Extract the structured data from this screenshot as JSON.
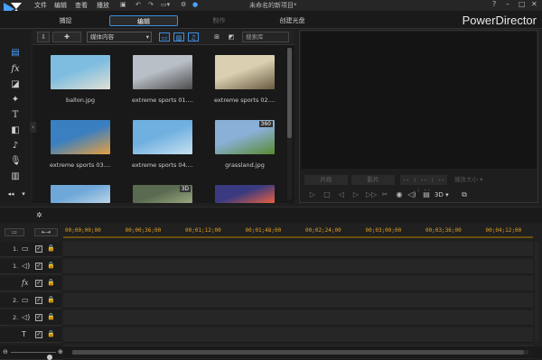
{
  "menu": {
    "file": "文件",
    "edit": "编辑",
    "view": "查看",
    "play": "播放"
  },
  "window_title": "未命名的新项目*",
  "brand": "PowerDirector",
  "modes": {
    "capture": "捕捉",
    "edit": "编辑",
    "produce": "制作",
    "create_disc": "创建光盘"
  },
  "library": {
    "media_filter": "媒体内容",
    "search_placeholder": "搜索库",
    "items": [
      {
        "name": "ballon.jpg",
        "colors": [
          "#7fbde0",
          "#e2e0d5"
        ]
      },
      {
        "name": "extreme sports 01....",
        "colors": [
          "#b9bfc6",
          "#4c4c4c"
        ]
      },
      {
        "name": "extreme sports 02....",
        "colors": [
          "#d8d0b0",
          "#6a5a40"
        ]
      },
      {
        "name": "extreme sports 03....",
        "colors": [
          "#3a7fc0",
          "#e8a040"
        ]
      },
      {
        "name": "extreme sports 04....",
        "colors": [
          "#6fb0e0",
          "#c8e0f0"
        ]
      },
      {
        "name": "grassland.jpg",
        "colors": [
          "#8ab0d8",
          "#5a8a30"
        ],
        "badge": "360"
      },
      {
        "name": "",
        "colors": [
          "#6fa8d8",
          "#bcd4e8"
        ]
      },
      {
        "name": "",
        "colors": [
          "#5a6a50",
          "#9aa880"
        ],
        "badge": "3D"
      },
      {
        "name": "",
        "colors": [
          "#3a3a80",
          "#e86040"
        ]
      }
    ]
  },
  "preview": {
    "clip_tab": "片段",
    "movie_tab": "影片",
    "timecode": "-- : -- : -- : --",
    "quality": "播放大小"
  },
  "timeline": {
    "ticks": [
      "00;00;00;00",
      "00;00;36;00",
      "00;01;12;00",
      "00;01;48;00",
      "00;02;24;00",
      "00;03;00;00",
      "00;03;36;00",
      "00;04;12;00"
    ],
    "tracks": [
      {
        "num": "1.",
        "icon": "video-track-icon",
        "glyph": "▭"
      },
      {
        "num": "1.",
        "icon": "audio-track-icon",
        "glyph": "◁)"
      },
      {
        "num": "",
        "icon": "fx-track-icon",
        "glyph": "fx"
      },
      {
        "num": "2.",
        "icon": "video-track-icon",
        "glyph": "▭"
      },
      {
        "num": "2.",
        "icon": "audio-track-icon",
        "glyph": "◁)"
      },
      {
        "num": "",
        "icon": "title-track-icon",
        "glyph": "T"
      },
      {
        "num": "",
        "icon": "voice-track-icon",
        "glyph": "♫"
      }
    ]
  },
  "accent_color": "#3e8ee0"
}
